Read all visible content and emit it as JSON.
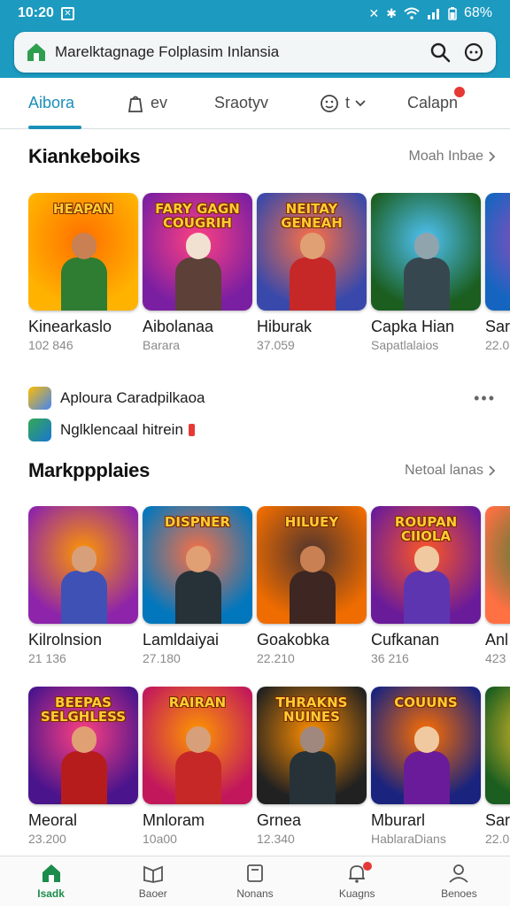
{
  "status": {
    "time": "10:20",
    "battery": "68%"
  },
  "search": {
    "text": "Marelktagnage Folplasim Inlansia"
  },
  "tabs": [
    {
      "label": "Aibora",
      "icon": "none",
      "active": true
    },
    {
      "label": "ev",
      "icon": "bag-icon"
    },
    {
      "label": "Sraotyv",
      "icon": "chevron-down-icon"
    },
    {
      "label": "t",
      "icon": "face-icon"
    },
    {
      "label": "Calapn",
      "icon": "none",
      "badge": true
    }
  ],
  "section1": {
    "title": "Kiankeboiks",
    "more": "Moah Inbae",
    "cards": [
      {
        "name": "Kinearkaslo",
        "sub": "102 846",
        "banner": "HEAPAN",
        "bg": [
          "#ffb300",
          "#ff6f00"
        ],
        "skin": "#c98052",
        "shirt": "#2e7d32"
      },
      {
        "name": "Aibolanaa",
        "sub": "Barara",
        "banner": "FARY GAGN COUGRIH",
        "bg": [
          "#7b1fa2",
          "#ff4081"
        ],
        "skin": "#f1e1d0",
        "shirt": "#5d4037"
      },
      {
        "name": "Hiburak",
        "sub": "37.059",
        "banner": "NEITAY GENEAH",
        "bg": [
          "#3949ab",
          "#ff7043"
        ],
        "skin": "#e0a074",
        "shirt": "#c62828"
      },
      {
        "name": "Capka Hian",
        "sub": "Sapatlalaios",
        "banner": "",
        "bg": [
          "#1b5e20",
          "#4fc3f7"
        ],
        "skin": "#90a4ae",
        "shirt": "#37474f"
      },
      {
        "name": "Sar",
        "sub": "22.0",
        "banner": "",
        "bg": [
          "#1565c0",
          "#ab47bc"
        ],
        "skin": "#d7a07a",
        "shirt": "#283593"
      }
    ]
  },
  "promos": [
    {
      "text": "Aploura Caradpilkaoa",
      "icon_colors": [
        "#fbbc05",
        "#4285f4"
      ]
    },
    {
      "text": "Nglklencaal hitrein",
      "icon_colors": [
        "#34a853",
        "#1976d2"
      ]
    }
  ],
  "section2": {
    "title": "Markppplaies",
    "more": "Netoal lanas",
    "cards": [
      {
        "name": "Kilrolnsion",
        "sub": "21 136",
        "banner": "",
        "bg": [
          "#8e24aa",
          "#ff9800"
        ],
        "skin": "#d7a07a",
        "shirt": "#3f51b5"
      },
      {
        "name": "Lamldaiyai",
        "sub": "27.180",
        "banner": "DISPNER",
        "bg": [
          "#0277bd",
          "#ff7043"
        ],
        "skin": "#e0a074",
        "shirt": "#263238"
      },
      {
        "name": "Goakobka",
        "sub": "22.210",
        "banner": "HILUEY",
        "bg": [
          "#ef6c00",
          "#4e342e"
        ],
        "skin": "#c98052",
        "shirt": "#3e2723"
      },
      {
        "name": "Cufkanan",
        "sub": "36 216",
        "banner": "ROUPAN CIIOLA",
        "bg": [
          "#6a1b9a",
          "#ff5722"
        ],
        "skin": "#f0c9a0",
        "shirt": "#5e35b1"
      },
      {
        "name": "Anl",
        "sub": "423",
        "banner": "",
        "bg": [
          "#ff7043",
          "#2e7d32"
        ],
        "skin": "#c98052",
        "shirt": "#6d4c41"
      }
    ]
  },
  "section3": {
    "cards": [
      {
        "name": "Meoral",
        "sub": "23.200",
        "banner": "BEEPAS SELGHLESS",
        "bg": [
          "#4a148c",
          "#ff4081"
        ],
        "skin": "#e0a074",
        "shirt": "#b71c1c"
      },
      {
        "name": "Mnloram",
        "sub": "10a00",
        "banner": "RAIRAN",
        "bg": [
          "#c2185b",
          "#ff9800"
        ],
        "skin": "#d7a07a",
        "shirt": "#c62828"
      },
      {
        "name": "Grnea",
        "sub": "12.340",
        "banner": "THRAKNS NUINES",
        "bg": [
          "#212121",
          "#ff8f00"
        ],
        "skin": "#a1887f",
        "shirt": "#263238"
      },
      {
        "name": "Mburarl",
        "sub": "HablaraDians",
        "banner": "COUUNS",
        "bg": [
          "#1a237e",
          "#ff6f00"
        ],
        "skin": "#f0c9a0",
        "shirt": "#6a1b9a"
      },
      {
        "name": "Sar",
        "sub": "22.0",
        "banner": "",
        "bg": [
          "#1b5e20",
          "#ffca28"
        ],
        "skin": "#c98052",
        "shirt": "#33691e"
      }
    ]
  },
  "nav": [
    {
      "label": "Isadk",
      "active": true
    },
    {
      "label": "Baoer"
    },
    {
      "label": "Nonans"
    },
    {
      "label": "Kuagns",
      "badge": true
    },
    {
      "label": "Benoes"
    }
  ]
}
